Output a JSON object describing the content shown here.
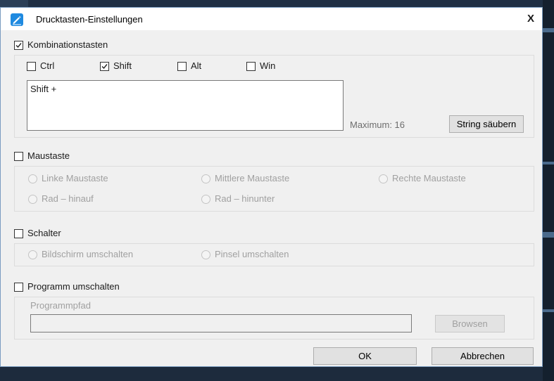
{
  "window": {
    "title": "Drucktasten-Einstellungen",
    "close_glyph": "X"
  },
  "combo": {
    "label": "Kombinationstasten",
    "ctrl": "Ctrl",
    "shift": "Shift",
    "alt": "Alt",
    "win": "Win",
    "text_value": "Shift +",
    "maximum": "Maximum: 16",
    "clear_button": "String säubern"
  },
  "mouse": {
    "label": "Maustaste",
    "left": "Linke Maustaste",
    "middle": "Mittlere Maustaste",
    "right": "Rechte Maustaste",
    "wheel_up": "Rad – hinauf",
    "wheel_down": "Rad – hinunter"
  },
  "switch": {
    "label": "Schalter",
    "screen": "Bildschirm umschalten",
    "brush": "Pinsel umschalten"
  },
  "program": {
    "label": "Programm umschalten",
    "path_label": "Programmpfad",
    "path_value": "",
    "browse_button": "Browsen"
  },
  "footer": {
    "ok": "OK",
    "cancel": "Abbrechen"
  },
  "colors": {
    "accent": "#1f8ae0",
    "disabled_text": "#a0a0a0",
    "dialog_bg": "#f0f0f0"
  },
  "icons": {
    "app": "pen-icon",
    "check": "check-icon"
  }
}
